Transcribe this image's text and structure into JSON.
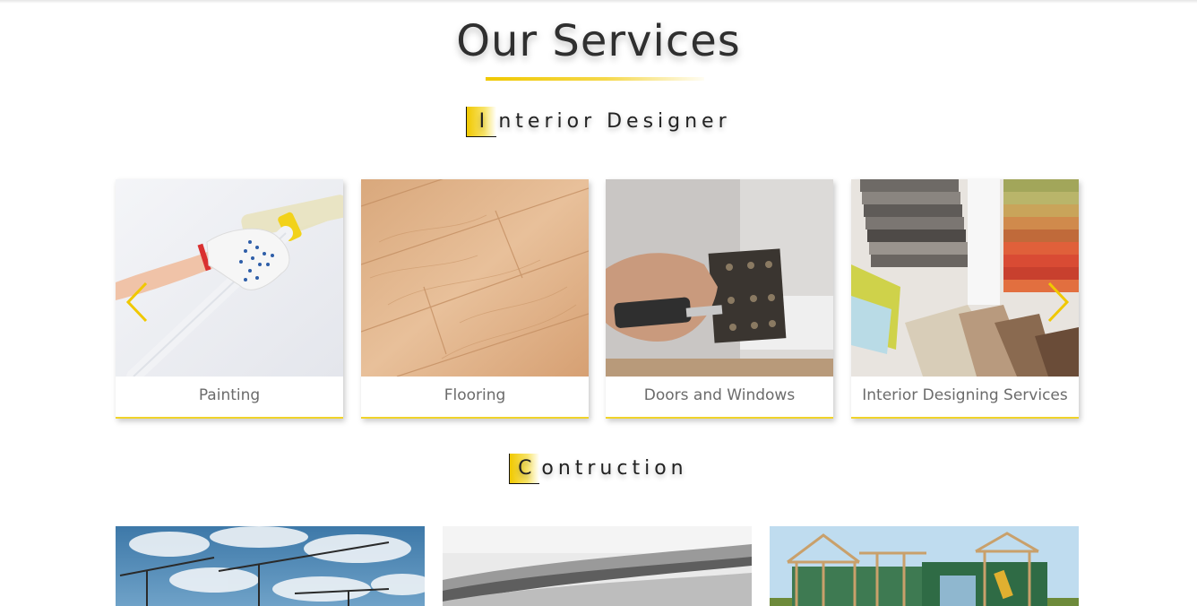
{
  "header": {
    "title": "Our Services"
  },
  "interior": {
    "heading_first": "I",
    "heading_rest": "nterior Designer",
    "cards": [
      {
        "label": "Painting"
      },
      {
        "label": "Flooring"
      },
      {
        "label": "Doors and Windows"
      },
      {
        "label": "Interior Designing Services"
      }
    ],
    "prev_icon": "chevron-left-icon",
    "next_icon": "chevron-right-icon"
  },
  "construction": {
    "heading_first": "C",
    "heading_rest": "ontruction",
    "images": [
      "crane-photo",
      "steel-rods-photo",
      "house-framing-photo"
    ]
  },
  "colors": {
    "accent": "#f0c800",
    "title": "#2f2f2f",
    "caption": "#6b6b6b"
  }
}
